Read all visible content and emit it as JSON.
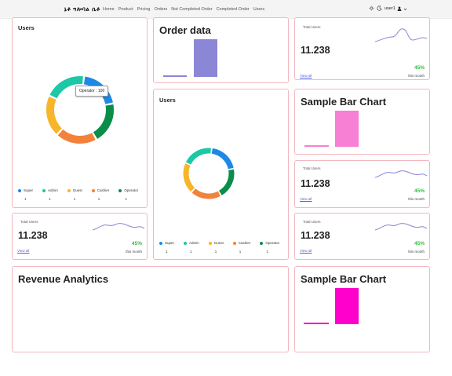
{
  "topbar": {
    "brand": "ኔቶ ግሎባል ሴቶ",
    "nav": [
      "Home",
      "Product",
      "Pricing",
      "Orders",
      "Not Completed Order",
      "Completed Order",
      "Users"
    ],
    "user": "user1"
  },
  "users_panel": {
    "title": "Users",
    "tooltip": "Operator : 100",
    "legend": [
      {
        "name": "Super",
        "value": "1",
        "color": "#1e88e5"
      },
      {
        "name": "Admin",
        "value": "1",
        "color": "#1cc8a6"
      },
      {
        "name": "Guest",
        "value": "1",
        "color": "#f7b529"
      },
      {
        "name": "Cashier",
        "value": "1",
        "color": "#f2823a"
      },
      {
        "name": "Operator",
        "value": "1",
        "color": "#0b8d4a"
      }
    ]
  },
  "order_data": {
    "title": "Order data"
  },
  "users_panel_2": {
    "title": "Users",
    "legend": [
      {
        "name": "Super",
        "value": "1",
        "color": "#1e88e5"
      },
      {
        "name": "Admin",
        "value": "1",
        "color": "#1cc8a6"
      },
      {
        "name": "Guest",
        "value": "1",
        "color": "#f7b529"
      },
      {
        "name": "Cashier",
        "value": "1",
        "color": "#f2823a"
      },
      {
        "name": "Operator",
        "value": "1",
        "color": "#0b8d4a"
      }
    ]
  },
  "stat_cards": [
    {
      "label": "Total Users",
      "value": "11.238",
      "percent": "45%",
      "sub": "this month",
      "link": "View all"
    },
    {
      "label": "Total Users",
      "value": "11.238",
      "percent": "45%",
      "sub": "this month",
      "link": "View all"
    },
    {
      "label": "Total Users",
      "value": "11.238",
      "percent": "45%",
      "sub": "this month",
      "link": "View all"
    },
    {
      "label": "Total Users",
      "value": "11.238",
      "percent": "45%",
      "sub": "this month",
      "link": "View all"
    }
  ],
  "bar_card_1": {
    "title": "Sample Bar Chart"
  },
  "bar_card_2": {
    "title": "Sample Bar Chart"
  },
  "revenue": {
    "title": "Revenue Analytics"
  },
  "colors": {
    "border": "#f2b7bf",
    "order_bar": "#8b86d6",
    "pink_bar": "#f77fd4",
    "magenta_bar": "#ff00cc",
    "link": "#5b5bd6",
    "positive": "#2fbf3f"
  }
}
